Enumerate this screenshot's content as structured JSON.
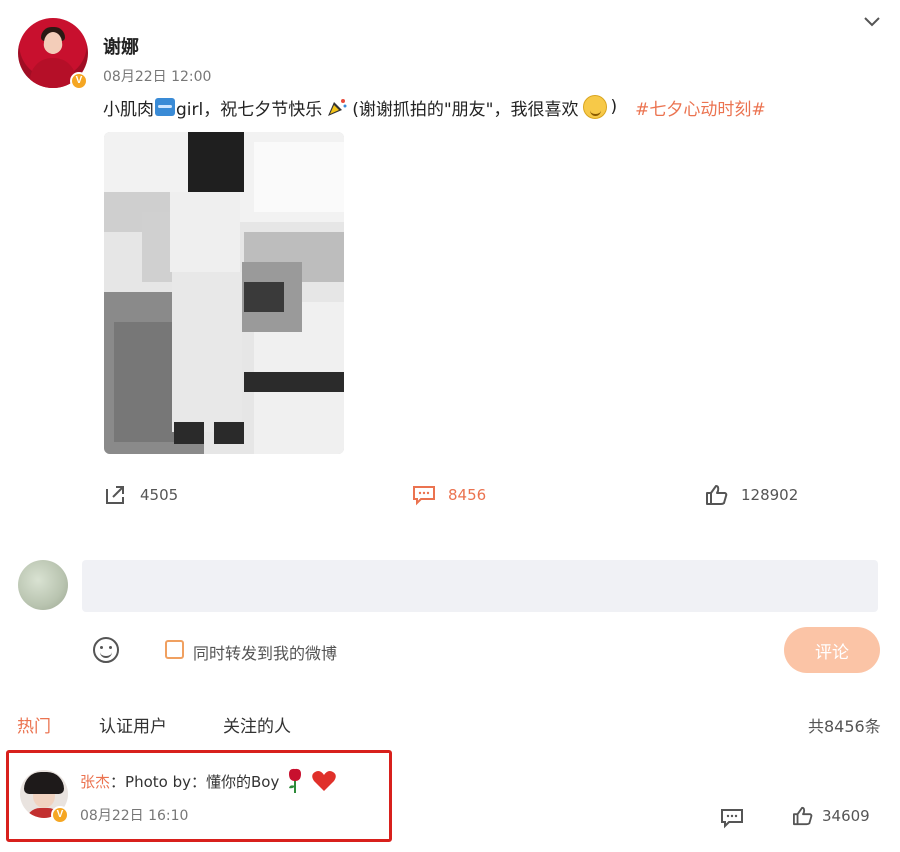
{
  "post": {
    "author": "谢娜",
    "timestamp": "08月22日 12:00",
    "text": {
      "part1": "小肌肉",
      "part2": "girl，祝七夕节快乐",
      "part3": "(谢谢抓拍的\"朋友\"，我很喜欢",
      "part4": ")",
      "hashtag": "#七夕心动时刻#"
    },
    "stats": {
      "reposts": "4505",
      "comments": "8456",
      "likes": "128902"
    }
  },
  "composer": {
    "input_placeholder": "",
    "repost_label": "同时转发到我的微博",
    "submit_label": "评论"
  },
  "tabs": [
    {
      "label": "热门",
      "active": true
    },
    {
      "label": "认证用户",
      "active": false
    },
    {
      "label": "关注的人",
      "active": false
    }
  ],
  "total_comments": "共8456条",
  "comments": [
    {
      "author": "张杰",
      "separator": "：",
      "text": "Photo by：懂你的Boy",
      "timestamp": "08月22日 16:10",
      "likes": "34609"
    }
  ],
  "colors": {
    "accent": "#eb7350",
    "highlight_border": "#d8201c",
    "submit_disabled": "#fbc4a6",
    "verified_badge": "#f5a623"
  }
}
